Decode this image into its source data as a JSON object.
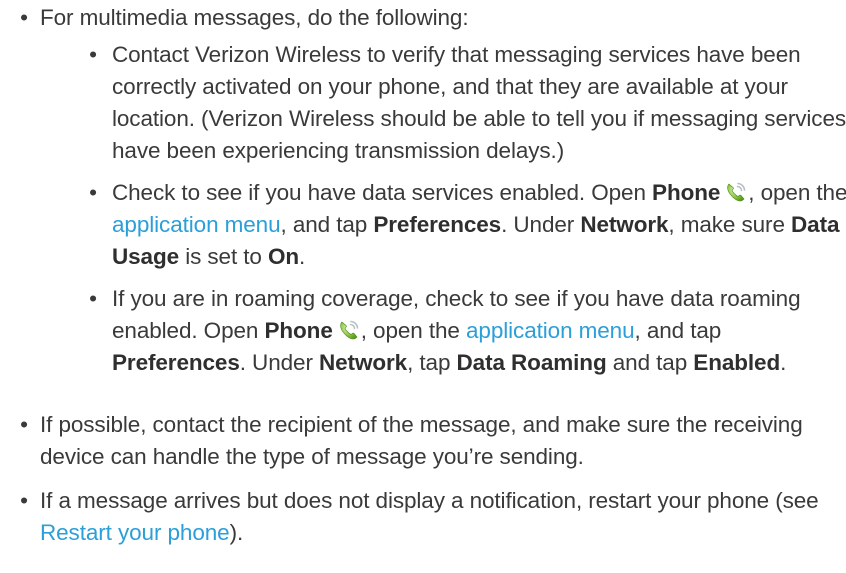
{
  "bullet_char": "•",
  "items": {
    "multimedia": {
      "text": "For multimedia messages, do the following:",
      "sub": {
        "verify": {
          "text": "Contact Verizon Wireless to verify that messaging services have been correctly activated on your phone, and that they are available at your location. (Verizon Wireless should be able to tell you if messaging services have been experiencing transmission delays.)"
        },
        "data": {
          "t1": "Check to see if you have data services enabled. Open ",
          "phone": "Phone",
          "t2": ", open the ",
          "app_menu_link": "application menu",
          "t3": ", and tap ",
          "preferences": "Preferences",
          "t4": ". Under ",
          "network": "Network",
          "t5": ", make sure ",
          "data_usage": "Data Usage",
          "t6": " is set to ",
          "on": "On",
          "t7": "."
        },
        "roaming": {
          "t1": "If you are in roaming coverage, check to see if you have data roaming enabled. Open ",
          "phone": "Phone",
          "t2": ", open the ",
          "app_menu_link": "application menu",
          "t3": ", and tap ",
          "preferences": "Preferences",
          "t4": ". Under ",
          "network": "Network",
          "t5": ", tap ",
          "data_roaming": "Data Roaming",
          "t6": " and tap ",
          "enabled": "Enabled",
          "t7": "."
        }
      }
    },
    "recipient": {
      "text": "If possible, contact the recipient of the message, and make sure the receiving device can handle the type of message you’re sending."
    },
    "notification": {
      "t1": "If a message arrives but does not display a notification, restart your phone (see ",
      "restart_link": "Restart your phone",
      "t2": ")."
    }
  },
  "colors": {
    "body_text": "#3a3a3a",
    "link": "#2a9fd8"
  },
  "icons": {
    "phone": "phone-app-icon"
  }
}
